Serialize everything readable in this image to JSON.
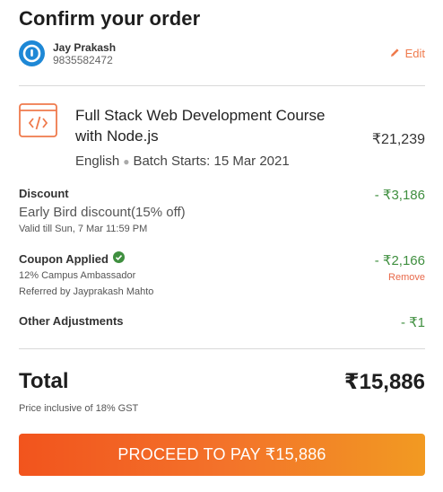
{
  "header": {
    "title": "Confirm your order"
  },
  "user": {
    "name": "Jay Prakash",
    "phone": "9835582472",
    "edit_label": "Edit"
  },
  "course": {
    "title": "Full Stack Web Development Course with Node.js",
    "language": "English",
    "batch": "Batch Starts: 15 Mar 2021",
    "price": "₹21,239"
  },
  "discount": {
    "label": "Discount",
    "name": "Early Bird discount(15% off)",
    "validity": "Valid till Sun, 7 Mar 11:59 PM",
    "amount": "- ₹3,186"
  },
  "coupon": {
    "label": "Coupon Applied",
    "detail": "12% Campus Ambassador",
    "referrer": "Referred by Jayprakash Mahto",
    "amount": "- ₹2,166",
    "remove_label": "Remove"
  },
  "adjustments": {
    "label": "Other Adjustments",
    "amount": "- ₹1"
  },
  "total": {
    "label": "Total",
    "amount": "₹15,886",
    "note": "Price inclusive of 18% GST"
  },
  "cta": {
    "label": "PROCEED TO PAY ₹15,886"
  },
  "colors": {
    "accent": "#ef7a4c",
    "green": "#3f8f3f",
    "avatar": "#1e88d6"
  },
  "icons": {
    "avatar": "power-logo-icon",
    "edit": "pencil-icon",
    "course": "code-icon",
    "coupon": "check-circle-icon"
  }
}
